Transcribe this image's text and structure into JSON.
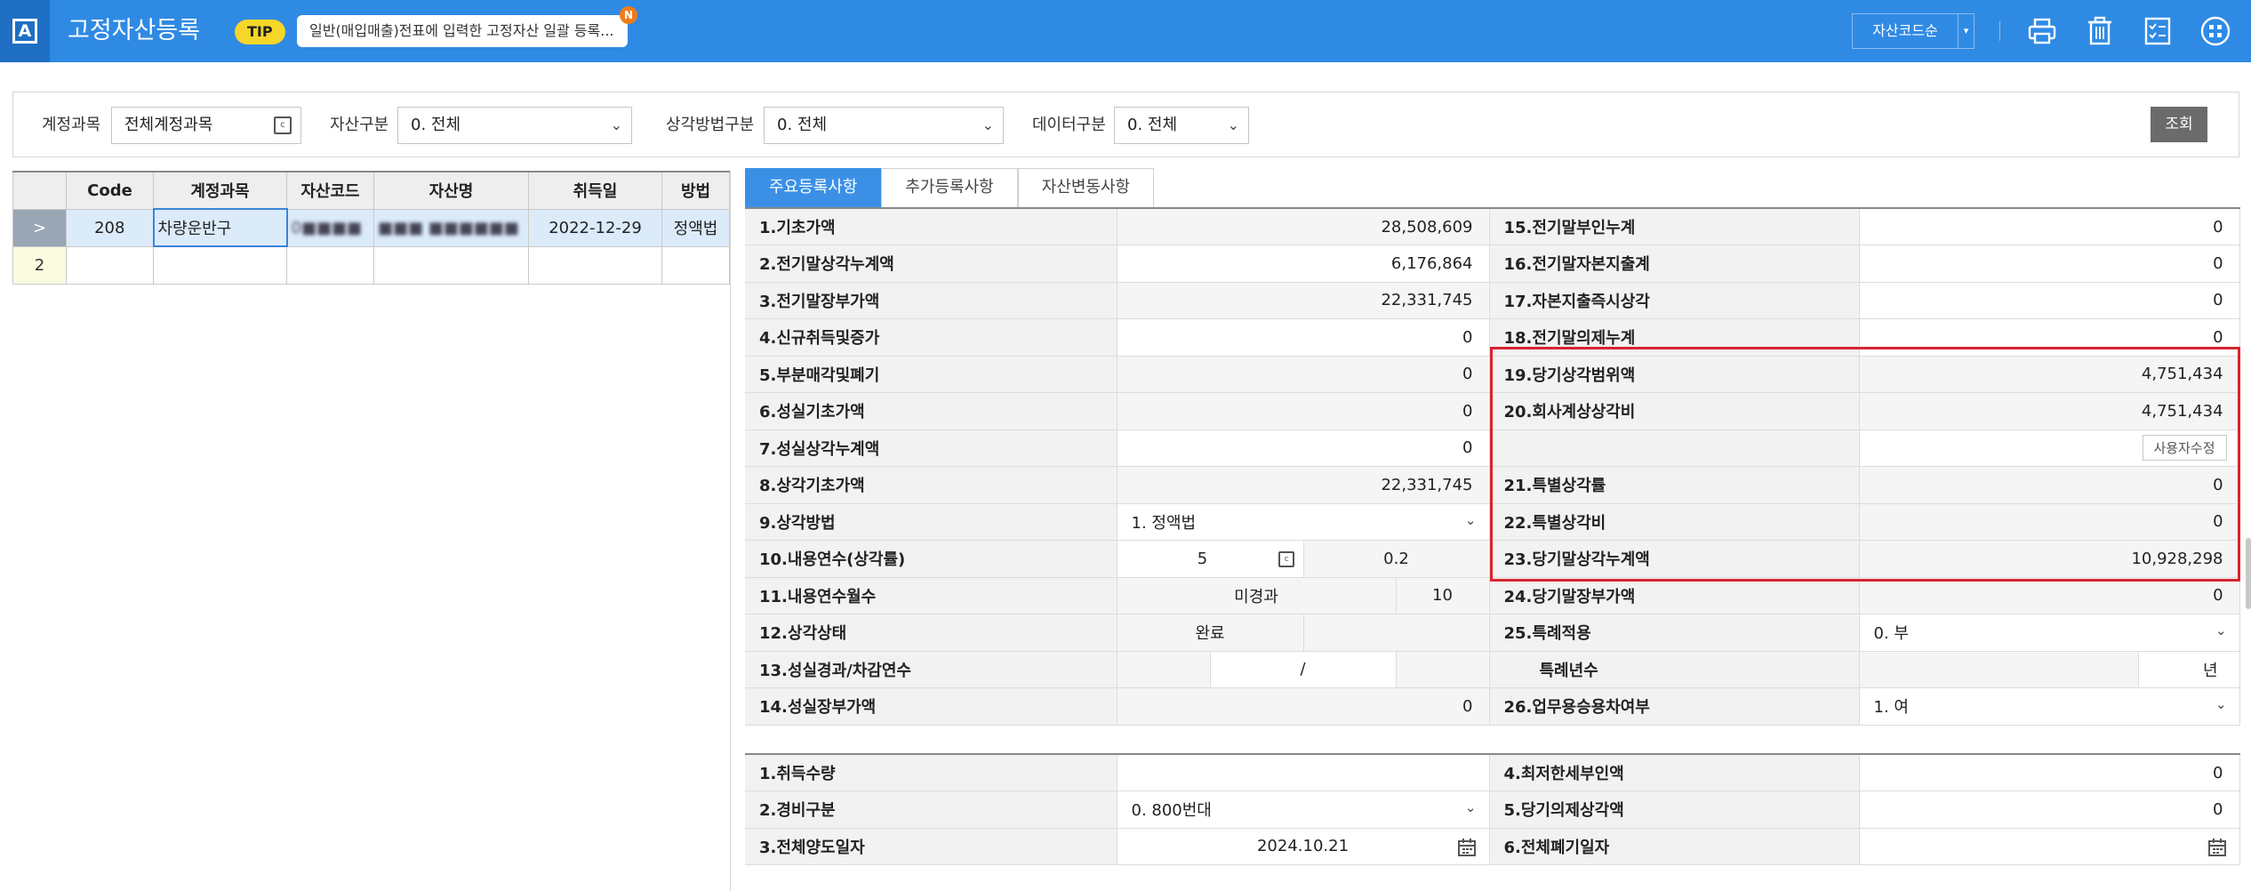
{
  "app": {
    "logo": "A",
    "title": "고정자산등록",
    "tip_badge": "TIP",
    "tip_text": "일반(매입매출)전표에 입력한 고정자산 일괄 등록...",
    "tip_new": "N",
    "sort_label": "자산코드순",
    "icons": [
      "print-icon",
      "trash-icon",
      "checklist-icon",
      "grid-menu-icon"
    ]
  },
  "filters": {
    "account_label": "계정과목",
    "account_value": "전체계정과목",
    "asset_type_label": "자산구분",
    "asset_type_value": "0. 전체",
    "method_label": "상각방법구분",
    "method_value": "0. 전체",
    "data_type_label": "데이터구분",
    "data_type_value": "0. 전체",
    "search_button": "조회"
  },
  "asset_list": {
    "headers": [
      "Code",
      "계정과목",
      "자산코드",
      "자산명",
      "취득일",
      "방법"
    ],
    "rows": [
      {
        "row_marker": ">",
        "code": "208",
        "account": "차량운반구",
        "asset_code": "0■■■■",
        "asset_name": "■■■ ■■■■■■",
        "acquired": "2022-12-29",
        "method": "정액법"
      }
    ],
    "new_row_marker": "2"
  },
  "tabs": [
    "주요등록사항",
    "추가등록사항",
    "자산변동사항"
  ],
  "main": {
    "left": [
      {
        "label": "1.기초가액",
        "value": "28,508,609"
      },
      {
        "label": "2.전기말상각누계액",
        "value": "6,176,864"
      },
      {
        "label": "3.전기말장부가액",
        "value": "22,331,745"
      },
      {
        "label": "4.신규취득및증가",
        "value": "0"
      },
      {
        "label": "5.부분매각및폐기",
        "value": "0"
      },
      {
        "label": "6.성실기초가액",
        "value": "0"
      },
      {
        "label": "7.성실상각누계액",
        "value": "0"
      },
      {
        "label": "8.상각기초가액",
        "value": "22,331,745"
      },
      {
        "label": "9.상각방법",
        "value": "1. 정액법"
      },
      {
        "label": "10.내용연수(상각률)",
        "value": "5",
        "value2": "0.2"
      },
      {
        "label": "11.내용연수월수",
        "value": "미경과",
        "value2": "10"
      },
      {
        "label": "12.상각상태",
        "value": "완료"
      },
      {
        "label": "13.성실경과/차감연수",
        "value": "/"
      },
      {
        "label": "14.성실장부가액",
        "value": "0"
      }
    ],
    "right": [
      {
        "label": "15.전기말부인누계",
        "value": "0"
      },
      {
        "label": "16.전기말자본지출계",
        "value": "0"
      },
      {
        "label": "17.자본지출즉시상각",
        "value": "0"
      },
      {
        "label": "18.전기말의제누계",
        "value": "0"
      },
      {
        "label": "19.당기상각범위액",
        "value": "4,751,434"
      },
      {
        "label": "20.회사계상상각비",
        "value": "4,751,434"
      },
      {
        "label": "",
        "value": "사용자수정"
      },
      {
        "label": "21.특별상각률",
        "value": "0"
      },
      {
        "label": "22.특별상각비",
        "value": "0"
      },
      {
        "label": "23.당기말상각누계액",
        "value": "10,928,298"
      },
      {
        "label": "24.당기말장부가액",
        "value": "0"
      },
      {
        "label": "25.특례적용",
        "value": "0. 부"
      },
      {
        "label": "특례년수",
        "value": "년"
      },
      {
        "label": "26.업무용승용차여부",
        "value": "1. 여"
      }
    ]
  },
  "extra": {
    "left": [
      {
        "label": "1.취득수량",
        "value": ""
      },
      {
        "label": "2.경비구분",
        "value": "0. 800번대"
      },
      {
        "label": "3.전체양도일자",
        "value": "2024.10.21"
      }
    ],
    "right": [
      {
        "label": "4.최저한세부인액",
        "value": "0"
      },
      {
        "label": "5.당기의제상각액",
        "value": "0"
      },
      {
        "label": "6.전체폐기일자",
        "value": ""
      }
    ]
  }
}
